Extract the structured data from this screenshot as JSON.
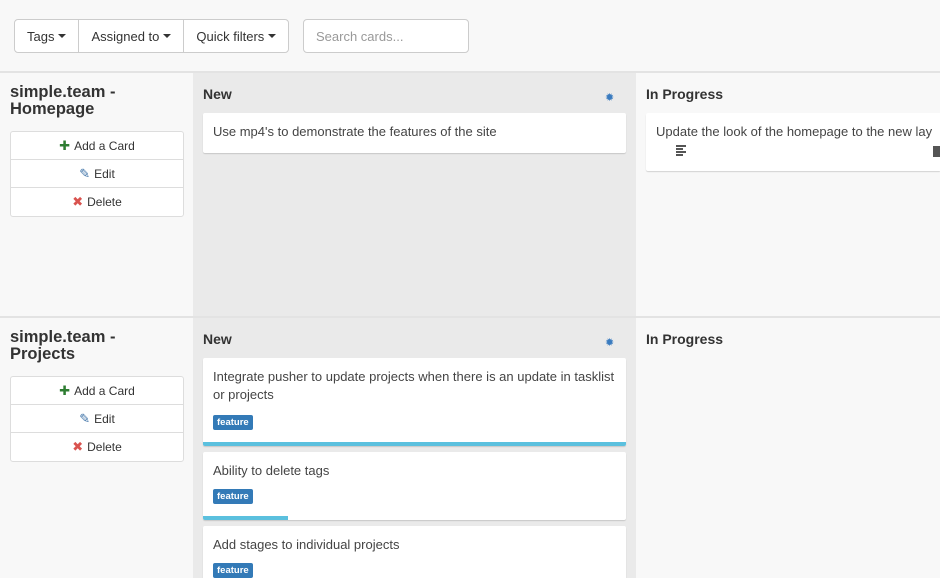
{
  "toolbar": {
    "filters": [
      {
        "label": "Tags"
      },
      {
        "label": "Assigned to"
      },
      {
        "label": "Quick filters"
      }
    ],
    "search_placeholder": "Search cards..."
  },
  "actions": {
    "add": "Add a Card",
    "edit": "Edit",
    "delete": "Delete"
  },
  "boards": [
    {
      "title": "simple.team - Homepage",
      "stages": [
        {
          "name": "New",
          "cards": [
            {
              "text": "Use mp4's to demonstrate the features of the site"
            }
          ]
        },
        {
          "name": "In Progress",
          "cards": [
            {
              "text": "Update the look of the homepage to the new lay"
            }
          ]
        }
      ]
    },
    {
      "title": "simple.team - Projects",
      "stages": [
        {
          "name": "New",
          "cards": [
            {
              "text": "Integrate pusher to update projects when there is an update in tasklist or projects",
              "tag": "feature",
              "progress": 1.0
            },
            {
              "text": "Ability to delete tags",
              "tag": "feature",
              "progress": 0.2
            },
            {
              "text": "Add stages to individual projects",
              "tag": "feature"
            }
          ]
        },
        {
          "name": "In Progress",
          "cards": []
        }
      ]
    }
  ],
  "icons": {
    "caret": "caret-down-icon",
    "plus": "plus-icon",
    "pencil": "pencil-icon",
    "x": "x-icon",
    "gear": "gear-icon"
  },
  "colors": {
    "tag": "#337ab7",
    "progress": "#5bc0de",
    "add": "#2e7d32",
    "delete": "#d9534f",
    "gear": "#3a7bbf"
  }
}
